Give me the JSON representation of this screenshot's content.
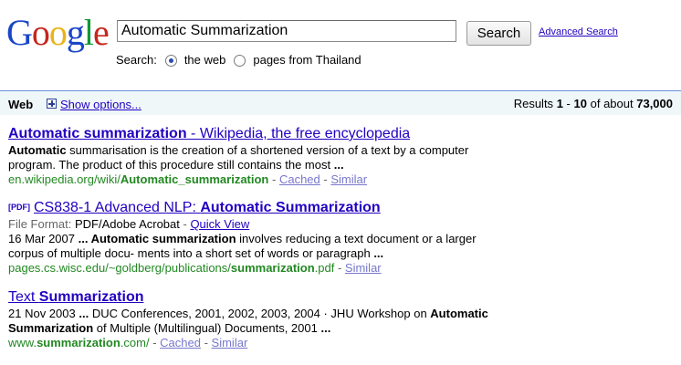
{
  "logo": {
    "letters": [
      "G",
      "o",
      "o",
      "g",
      "l",
      "e"
    ],
    "colors": [
      "#1a46c6",
      "#c5271d",
      "#e8b41a",
      "#1a46c6",
      "#0f9936",
      "#c5271d"
    ]
  },
  "search": {
    "query": "Automatic Summarization",
    "button_label": "Search",
    "advanced_label": "Advanced Search"
  },
  "search_scope": {
    "label": "Search:",
    "options": [
      "the web",
      "pages from Thailand"
    ],
    "selected": "the web"
  },
  "results_bar": {
    "web_label": "Web",
    "show_options": "Show options...",
    "stats_prefix": "Results",
    "range_start": "1",
    "range_sep": "-",
    "range_end": "10",
    "of_about": "of about",
    "total": "73,000"
  },
  "results": [
    {
      "title_hl": "Automatic summarization",
      "title_rest": " - Wikipedia, the free encyclopedia",
      "snippet_b1": "Automatic",
      "snippet_t1": " summarisation is the creation of a shortened version of a text by a computer program. The product of this procedure still contains the most ",
      "snippet_b2": "...",
      "url_pre": "en.wikipedia.org/wiki/",
      "url_hl": "Automatic_summarization",
      "cached": "Cached",
      "similar": "Similar"
    },
    {
      "pdf_tag": "[PDF]",
      "title_pre": "CS838-1 Advanced NLP: ",
      "title_hl": "Automatic Summarization",
      "file_format_label": "File Format:",
      "file_format": "PDF/Adobe Acrobat",
      "quick_view": "Quick View",
      "date": "16 Mar 2007",
      "snippet_b1": "... Automatic summarization",
      "snippet_t1": " involves reducing a text document or a larger corpus of multiple docu- ments into a short set of words or paragraph ",
      "snippet_b2": "...",
      "url_pre": "pages.cs.wisc.edu/~goldberg/publications/",
      "url_hl": "summarization",
      "url_post": ".pdf",
      "similar": "Similar"
    },
    {
      "title_pre": "Text ",
      "title_hl": "Summarization",
      "date": "21 Nov 2003",
      "snippet_b1": "...",
      "snippet_t1": " DUC Conferences, 2001, 2002, 2003, 2004 · JHU Workshop on ",
      "snippet_b2": "Automatic Summarization",
      "snippet_t2": " of Multiple (Multilingual) Documents, 2001 ",
      "snippet_b3": "...",
      "url_pre": "www.",
      "url_hl": "summarization",
      "url_post": ".com/",
      "cached": "Cached",
      "similar": "Similar"
    }
  ],
  "separators": {
    "dash": " - "
  }
}
